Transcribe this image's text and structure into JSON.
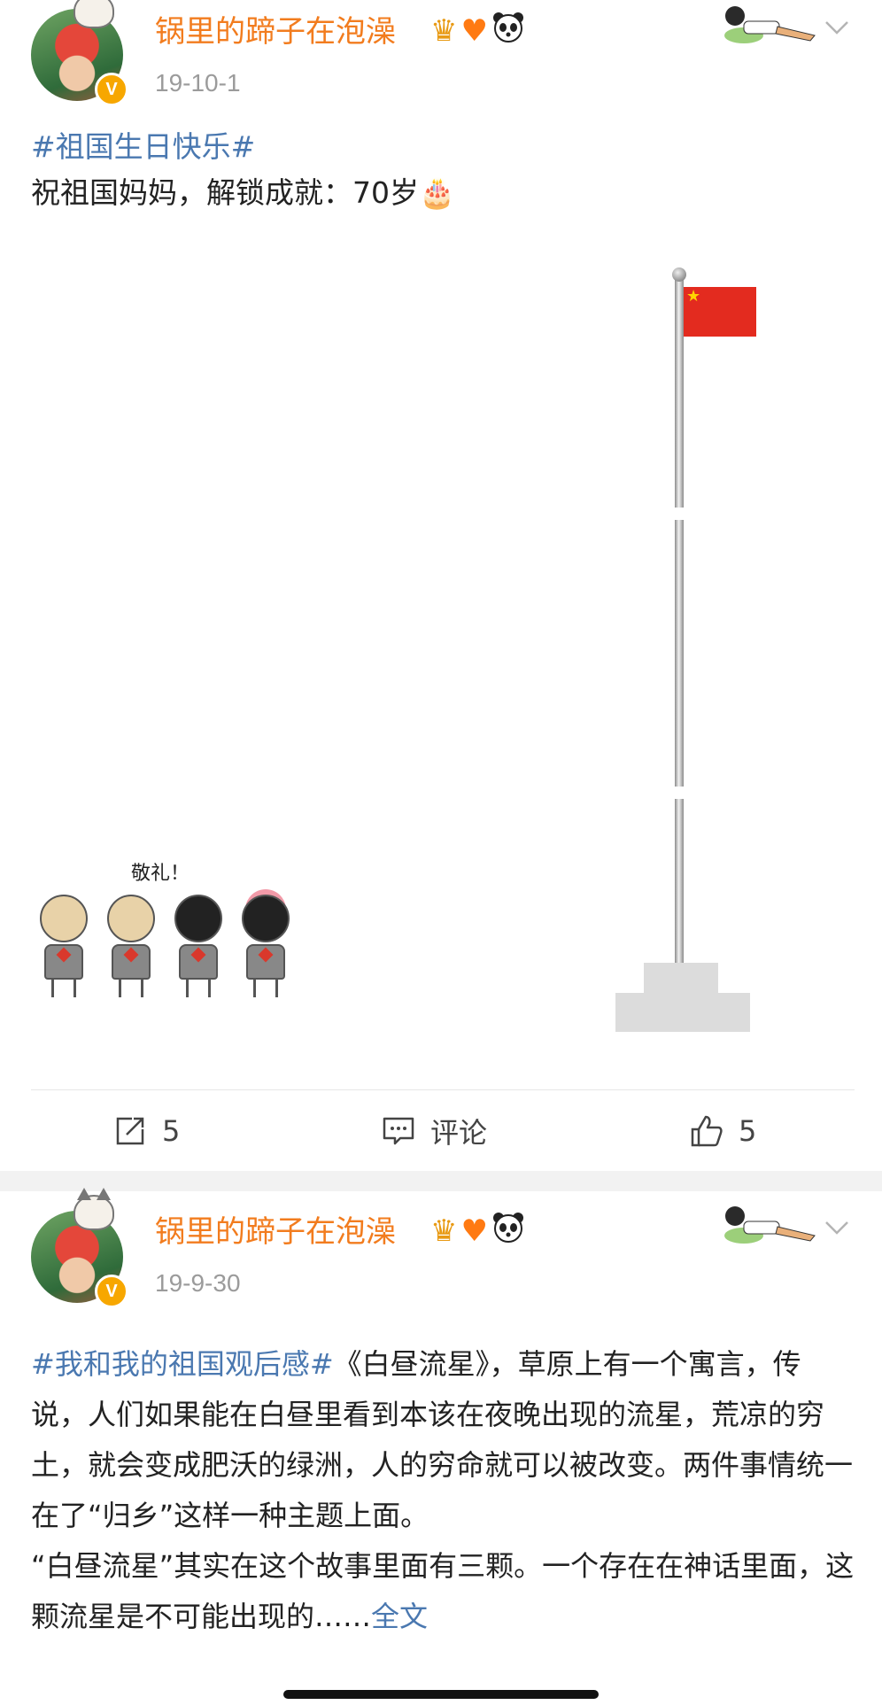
{
  "posts": [
    {
      "username": "锅里的蹄子在泡澡",
      "verified_badge": "V",
      "badges": [
        "crown-icon",
        "heart-icon",
        "panda-icon"
      ],
      "date": "19-10-1",
      "hashtag": "#祖国生日快乐#",
      "text": "祝祖国妈妈，解锁成就：70岁",
      "text_emoji": "🎂",
      "image_caption": "敬礼！",
      "actions": {
        "share_count": "5",
        "comment_label": "评论",
        "like_count": "5"
      }
    },
    {
      "username": "锅里的蹄子在泡澡",
      "verified_badge": "V",
      "badges": [
        "crown-icon",
        "heart-icon",
        "panda-icon"
      ],
      "date": "19-9-30",
      "hashtag": "#我和我的祖国观后感#",
      "text_1": "《白昼流星》，草原上有一个寓言，传说，人们如果能在白昼里看到本该在夜晚出现的流星，荒凉的穷土，就会变成肥沃的绿洲，人的穷命就可以被改变。两件事情统一在了“归乡”这样一种主题上面。",
      "text_2": "“白昼流星”其实在这个故事里面有三颗。一个存在在神话里面，这颗流星是不可能出现的……",
      "read_more": "全文"
    }
  ],
  "colors": {
    "username": "#f27c1e",
    "hashtag": "#4a78b0",
    "date": "#9b9b9b",
    "flag_red": "#e32b1f",
    "verified": "#f7a700"
  }
}
